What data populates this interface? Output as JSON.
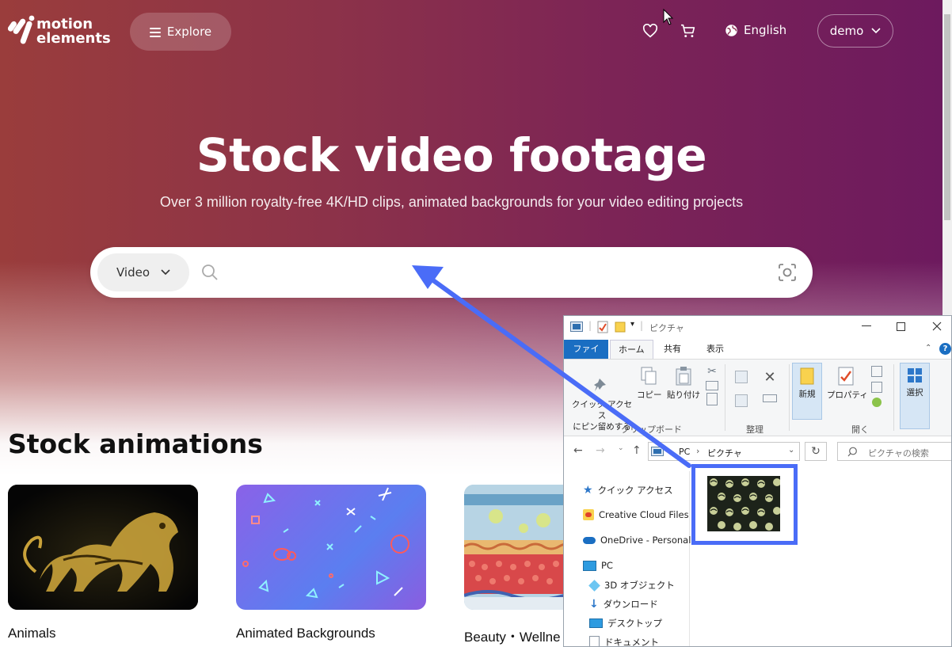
{
  "brand": {
    "line1": "motion",
    "line2": "elements"
  },
  "header": {
    "explore_label": "Explore",
    "language_label": "English",
    "user_label": "demo",
    "icons": [
      "heart-icon",
      "cart-icon",
      "globe-icon",
      "chevron-down-icon"
    ]
  },
  "hero": {
    "title": "Stock video footage",
    "subtitle": "Over 3 million royalty-free 4K/HD clips, animated backgrounds for your video editing projects"
  },
  "search": {
    "type_label": "Video",
    "placeholder": "",
    "value": ""
  },
  "section": {
    "title": "Stock animations",
    "cards": [
      {
        "label": "Animals"
      },
      {
        "label": "Animated Backgrounds"
      },
      {
        "label": "Beauty・Wellne"
      }
    ]
  },
  "overlay_color": "#4a6cf7",
  "explorer": {
    "title": "ピクチャ",
    "tabs": {
      "file": "ファイル",
      "home": "ホーム",
      "share": "共有",
      "view": "表示"
    },
    "ribbon": {
      "pin": "クイック アクセス\nにピン留めする",
      "copy": "コピー",
      "paste": "貼り付け",
      "group_clipboard": "クリップボード",
      "group_organize": "整理",
      "new": "新規",
      "properties": "プロパティ",
      "group_open": "開く",
      "select": "選択"
    },
    "address": {
      "pc": "PC",
      "folder": "ピクチャ",
      "search_placeholder": "ピクチャの検索"
    },
    "nav": [
      {
        "label": "クイック アクセス",
        "icon": "star-icon"
      },
      {
        "label": "Creative Cloud Files",
        "icon": "creative-cloud-icon"
      },
      {
        "label": "OneDrive - Personal",
        "icon": "onedrive-icon"
      },
      {
        "label": "PC",
        "icon": "pc-icon"
      },
      {
        "label": "3D オブジェクト",
        "icon": "cube-icon"
      },
      {
        "label": "ダウンロード",
        "icon": "download-icon"
      },
      {
        "label": "デスクトップ",
        "icon": "desktop-icon"
      },
      {
        "label": "ドキュメント",
        "icon": "document-icon"
      }
    ]
  }
}
